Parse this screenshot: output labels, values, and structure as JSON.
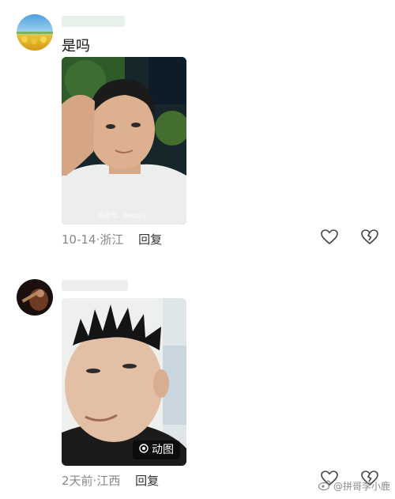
{
  "comments": [
    {
      "text": "是吗",
      "date": "10-14",
      "location": "浙江",
      "reply_label": "回复"
    },
    {
      "date": "2天前",
      "location": "江西",
      "reply_label": "回复",
      "gif_label": "动图"
    }
  ],
  "video_watermark": "抖音号：dxkszl1",
  "weibo_watermark": "@拼哥李小鹿",
  "icons": {
    "like": "heart-outline-icon",
    "dislike": "broken-heart-icon",
    "gif": "gif-icon"
  }
}
